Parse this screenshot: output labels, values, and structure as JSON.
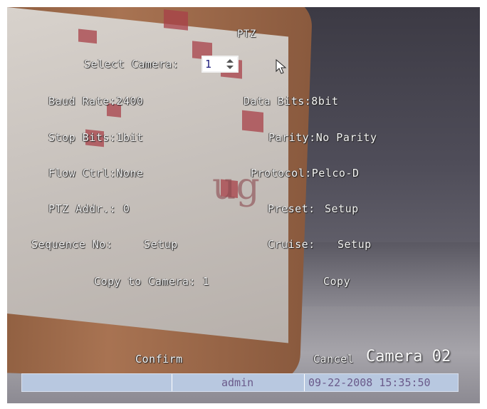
{
  "menu": {
    "title": "PTZ",
    "select_camera_label": "Select Camera:",
    "select_camera_value": "1",
    "baud_rate": "Baud Rate:2400",
    "data_bits": "Data Bits:8bit",
    "stop_bits": "Stop Bits:1bit",
    "parity": "Parity:No Parity",
    "flow_ctrl": "Flow Ctrl:None",
    "protocol": "Protocol:Pelco-D",
    "ptz_addr": "PTZ Addr.: 0",
    "preset_label": "Preset:",
    "preset_setup": "Setup",
    "sequence_label": "Sequence No:",
    "sequence_setup": "Setup",
    "cruise_label": "Cruise:",
    "cruise_setup": "Setup",
    "copy_to_camera": "Copy to Camera: 1",
    "copy_button": "Copy",
    "confirm_button": "Confirm",
    "cancel_button": "Cancel"
  },
  "overlay": {
    "camera_name": "Camera 02"
  },
  "status_bar": {
    "user": "admin",
    "datetime": "09-22-2008 15:35:50"
  },
  "icons": {
    "cursor": "mouse-pointer-icon",
    "spinner": "up-down-arrow-icon"
  },
  "colors": {
    "status_bar": "#b8c8e0",
    "status_text": "#6a5a8a",
    "osd_text": "#f4f4f4"
  }
}
